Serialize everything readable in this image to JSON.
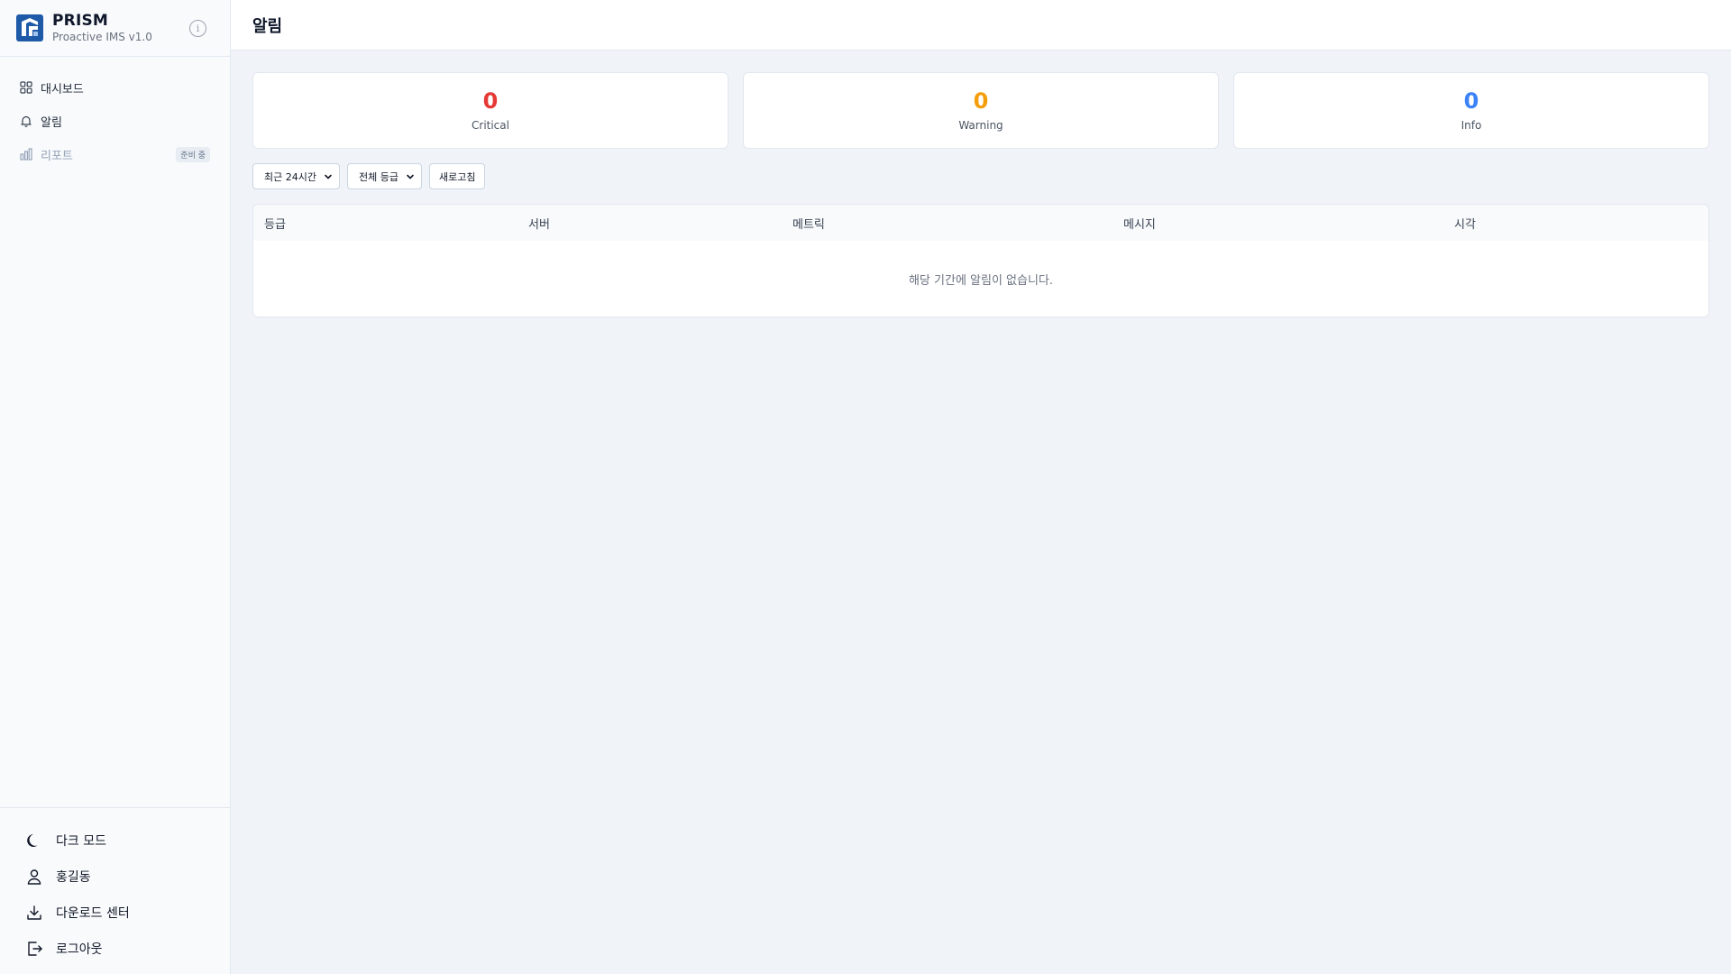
{
  "brand": {
    "name": "PRISM",
    "subtitle": "Proactive IMS v1.0"
  },
  "nav": [
    {
      "label": "대시보드",
      "icon": "grid-icon"
    },
    {
      "label": "알림",
      "icon": "bell-icon"
    },
    {
      "label": "리포트",
      "icon": "bar-chart-icon",
      "badge": "준비 중",
      "disabled": true
    }
  ],
  "bottom": [
    {
      "label": "다크 모드",
      "icon": "moon-icon"
    },
    {
      "label": "홍길동",
      "icon": "user-icon"
    },
    {
      "label": "다운로드 센터",
      "icon": "download-icon"
    },
    {
      "label": "로그아웃",
      "icon": "logout-icon"
    }
  ],
  "page": {
    "title": "알림"
  },
  "stats": [
    {
      "value": "0",
      "label": "Critical",
      "color": "#e53935"
    },
    {
      "value": "0",
      "label": "Warning",
      "color": "#f59e0b"
    },
    {
      "value": "0",
      "label": "Info",
      "color": "#3b82f6"
    }
  ],
  "filters": {
    "period": "최근 24시간",
    "severity": "전체 등급",
    "refresh": "새로고침"
  },
  "table": {
    "columns": [
      "등급",
      "서버",
      "메트릭",
      "메시지",
      "시각"
    ],
    "empty_message": "해당 기간에 알림이 없습니다."
  },
  "colors": {
    "accent": "#1e5aa8",
    "sidebar_bg": "#f8fafc",
    "page_bg": "#f0f3f8"
  }
}
